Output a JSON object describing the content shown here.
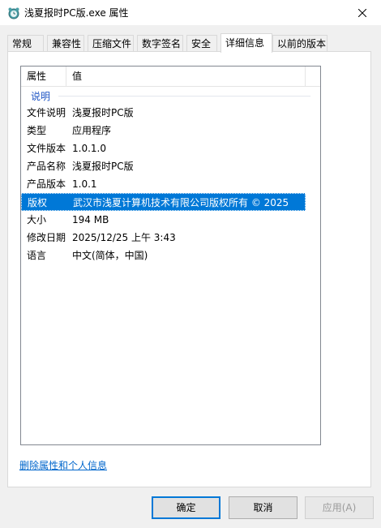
{
  "window": {
    "title": "浅夏报时PC版.exe 属性"
  },
  "tabs": [
    {
      "label": "常规"
    },
    {
      "label": "兼容性"
    },
    {
      "label": "压缩文件"
    },
    {
      "label": "数字签名"
    },
    {
      "label": "安全"
    },
    {
      "label": "详细信息"
    },
    {
      "label": "以前的版本"
    }
  ],
  "details": {
    "columns": {
      "property": "属性",
      "value": "值"
    },
    "group": "说明",
    "rows": [
      {
        "key": "文件说明",
        "value": "浅夏报时PC版"
      },
      {
        "key": "类型",
        "value": "应用程序"
      },
      {
        "key": "文件版本",
        "value": "1.0.1.0"
      },
      {
        "key": "产品名称",
        "value": "浅夏报时PC版"
      },
      {
        "key": "产品版本",
        "value": "1.0.1"
      },
      {
        "key": "版权",
        "value": "武汉市浅夏计算机技术有限公司版权所有 © 2025"
      },
      {
        "key": "大小",
        "value": "194 MB"
      },
      {
        "key": "修改日期",
        "value": "2025/12/25 上午 3:43"
      },
      {
        "key": "语言",
        "value": "中文(简体，中国)"
      }
    ]
  },
  "link": {
    "label": "删除属性和个人信息"
  },
  "buttons": {
    "ok": "确定",
    "cancel": "取消",
    "apply": "应用(A)"
  },
  "colors": {
    "accent": "#0078d7",
    "link": "#0066cc"
  }
}
